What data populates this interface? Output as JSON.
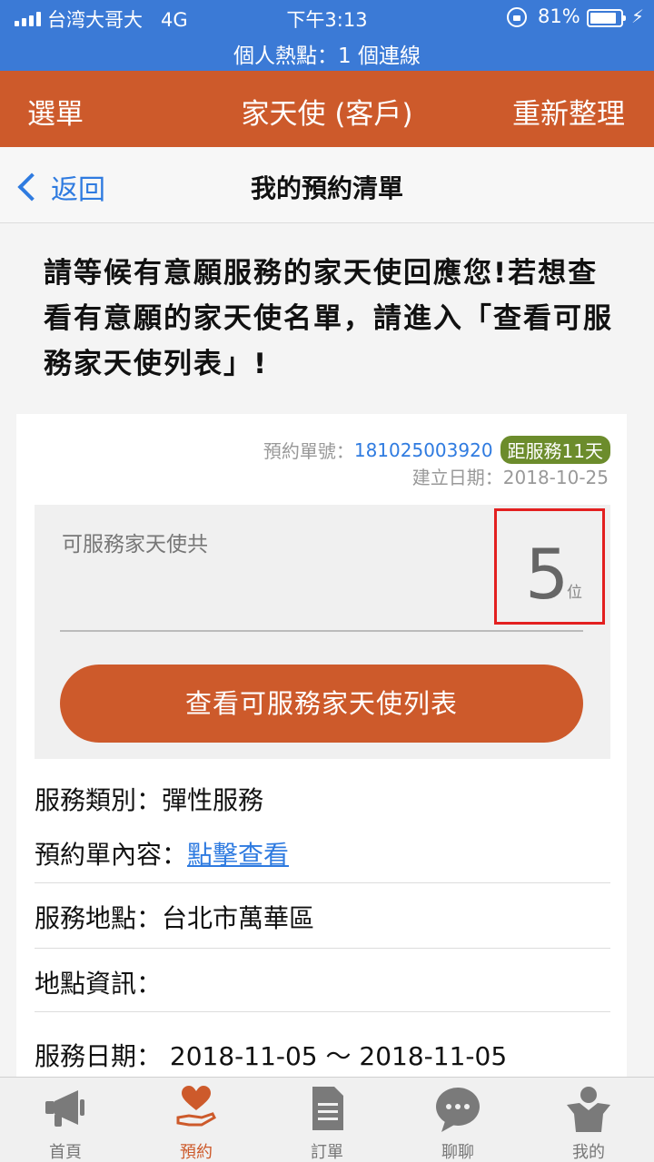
{
  "status": {
    "carrier": "台湾大哥大",
    "network": "4G",
    "time": "下午3:13",
    "battery": "81%",
    "hotspot": "個人熱點：1 個連線"
  },
  "header": {
    "menu": "選單",
    "title": "家天使 (客戶)",
    "refresh": "重新整理"
  },
  "nav": {
    "back": "返回",
    "title": "我的預約清單"
  },
  "notice": "請等候有意願服務的家天使回應您!若想查看有意願的家天使名單，請進入「查看可服務家天使列表」!",
  "order": {
    "number_label": "預約單號：",
    "number": "181025003920",
    "days_badge": "距服務11天",
    "created": "建立日期：2018-10-25",
    "available_label": "可服務家天使共",
    "available_count": "5",
    "available_unit": "位",
    "list_button": "查看可服務家天使列表"
  },
  "details": {
    "category": "服務類別：彈性服務",
    "content_label": "預約單內容：",
    "content_link": "點擊查看",
    "location": "服務地點：台北市萬華區",
    "location_info": "地點資訊：",
    "date": "服務日期： 2018-11-05 ～ 2018-11-05"
  },
  "tabs": [
    {
      "label": "首頁",
      "icon": "megaphone-icon"
    },
    {
      "label": "預約",
      "icon": "heart-hand-icon"
    },
    {
      "label": "訂單",
      "icon": "document-icon"
    },
    {
      "label": "聊聊",
      "icon": "chat-bubble-icon"
    },
    {
      "label": "我的",
      "icon": "angel-person-icon"
    }
  ],
  "colors": {
    "accent": "#cd5a2b",
    "status_bar": "#3b7ad6",
    "link": "#2f7be0",
    "badge": "#6c8c2c",
    "highlight": "#e32020"
  }
}
